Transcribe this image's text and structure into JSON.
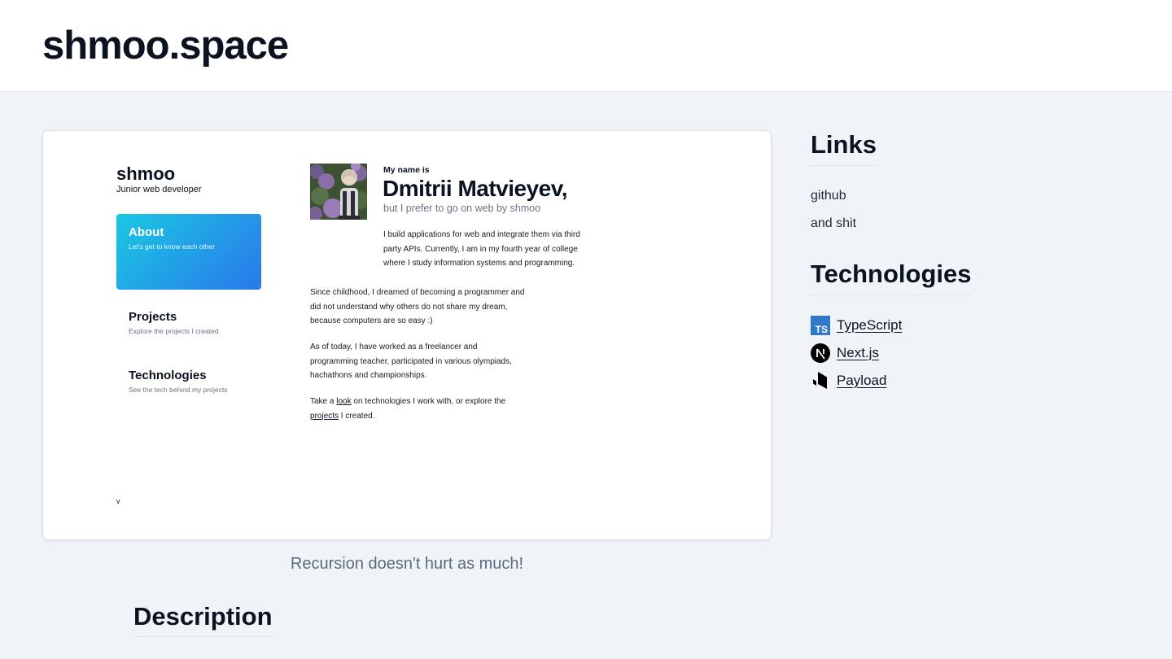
{
  "header": {
    "site_title": "shmoo.space"
  },
  "preview": {
    "brand": "shmoo",
    "role": "Junior web developer",
    "nav": [
      {
        "title": "About",
        "subtitle": "Let's get to know each other",
        "active": true
      },
      {
        "title": "Projects",
        "subtitle": "Explore the projects I created",
        "active": false
      },
      {
        "title": "Technologies",
        "subtitle": "See the tech behind my projects",
        "active": false
      }
    ],
    "intro": "My name is",
    "name": "Dmitrii Matvieyev,",
    "nickname_line": "but I prefer to go on web by shmoo",
    "bio_lines": [
      "I build applications for web and integrate them via third",
      "party APIs. Currently, I am in my fourth year of college",
      "where I study information systems and programming."
    ],
    "childhood_lines": [
      "Since childhood, I dreamed of becoming a programmer and",
      "did not understand why others do not share my dream,",
      "because computers are so easy :)"
    ],
    "work_lines": [
      "As of today, I have worked as a freelancer and",
      "programming teacher, participated in various olympiads,",
      "hachathons and championships."
    ],
    "cta": {
      "before_look": "Take a ",
      "look_link": "look",
      "after_look": " on technologies I work with, or explore the",
      "projects_link": "projects",
      "after_projects": " I created."
    },
    "footer_char": "v",
    "colors": {
      "gradient_start": "#1ac8e3",
      "gradient_end": "#2a78ea"
    }
  },
  "caption": "Recursion doesn't hurt as much!",
  "description_heading": "Description",
  "sidebar": {
    "links_heading": "Links",
    "links": [
      "github",
      "and shit"
    ],
    "tech_heading": "Technologies",
    "technologies": [
      {
        "label": "TypeScript",
        "icon": "typescript-icon",
        "color": "#3178c6"
      },
      {
        "label": "Next.js",
        "icon": "nextjs-icon",
        "color": "#000000"
      },
      {
        "label": "Payload",
        "icon": "payload-icon",
        "color": "#000000"
      }
    ]
  }
}
